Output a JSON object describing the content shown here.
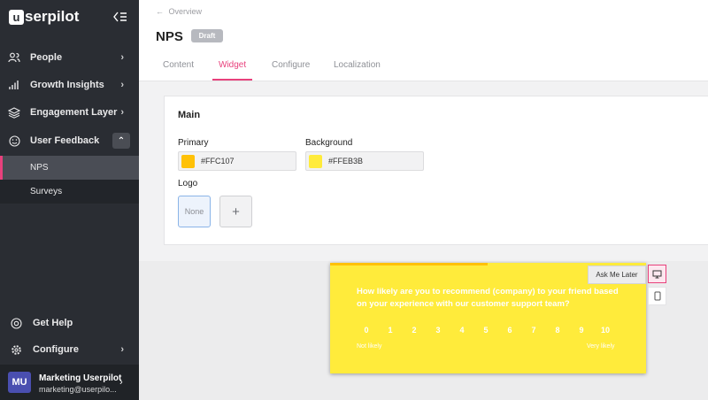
{
  "brand": {
    "logo_letter": "u",
    "logo_text": "serpilot"
  },
  "sidebar": {
    "items": [
      {
        "label": "People"
      },
      {
        "label": "Growth Insights"
      },
      {
        "label": "Engagement Layer"
      },
      {
        "label": "User Feedback"
      }
    ],
    "sub_items": [
      {
        "label": "NPS"
      },
      {
        "label": "Surveys"
      }
    ],
    "bottom": [
      {
        "label": "Get Help"
      },
      {
        "label": "Configure"
      }
    ],
    "user": {
      "initials": "MU",
      "name": "Marketing Userpilot",
      "email": "marketing@userpilo..."
    }
  },
  "header": {
    "back_label": "Overview",
    "title": "NPS",
    "badge": "Draft",
    "tabs": [
      {
        "label": "Content"
      },
      {
        "label": "Widget"
      },
      {
        "label": "Configure"
      },
      {
        "label": "Localization"
      }
    ]
  },
  "settings": {
    "section_title": "Main",
    "primary_label": "Primary",
    "primary_value": "#FFC107",
    "background_label": "Background",
    "background_value": "#FFEB3B",
    "logo_label": "Logo",
    "logo_none": "None",
    "logo_add": "+"
  },
  "widget": {
    "ask_later": "Ask Me Later",
    "question": "How likely are you to recommend (company) to your friend based on your experience with our customer support team?",
    "scores": [
      "0",
      "1",
      "2",
      "3",
      "4",
      "5",
      "6",
      "7",
      "8",
      "9",
      "10"
    ],
    "low_label": "Not likely",
    "high_label": "Very likely"
  },
  "colors": {
    "accent": "#e8417c",
    "sidebar_bg": "#2a2d33",
    "primary": "#FFC107",
    "background": "#FFEB3B"
  }
}
